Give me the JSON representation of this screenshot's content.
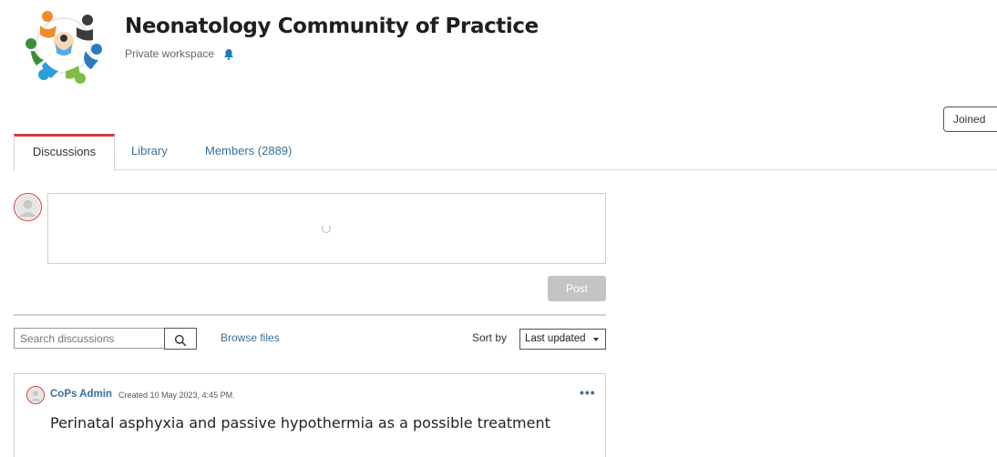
{
  "header": {
    "title": "Neonatology Community of Practice",
    "subtitle": "Private workspace",
    "joined_label": "Joined"
  },
  "tabs": [
    {
      "label": "Discussions",
      "active": true
    },
    {
      "label": "Library",
      "active": false
    },
    {
      "label": "Members (2889)",
      "active": false
    }
  ],
  "composer": {
    "post_label": "Post"
  },
  "toolbar": {
    "search_placeholder": "Search discussions",
    "browse_label": "Browse files",
    "sort_label": "Sort by",
    "sort_value": "Last updated"
  },
  "posts": [
    {
      "author": "CoPs Admin",
      "created": "Created 10 May 2023, 4:45 PM.",
      "more": "•••",
      "title": "Perinatal asphyxia and passive hypothermia as a possible treatment"
    }
  ],
  "colors": {
    "accent_red": "#d13b3b",
    "link_blue": "#3a6f9a",
    "post_button_disabled": "#c4c4c4"
  },
  "icons": {
    "logo": "community-logo",
    "bell": "bell-icon",
    "search": "search-icon",
    "avatar": "user-avatar-icon",
    "spinner": "loading-spinner-icon",
    "more": "more-options-icon"
  }
}
